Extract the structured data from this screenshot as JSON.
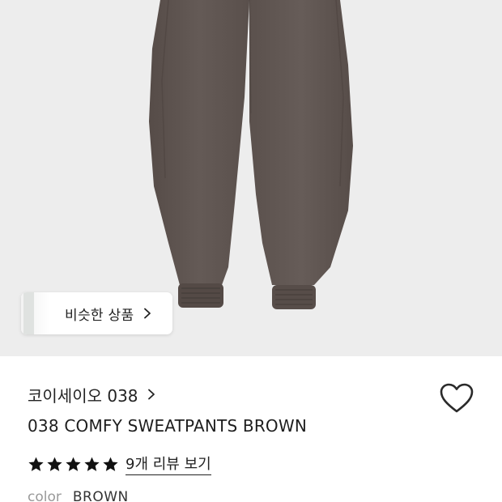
{
  "hero": {
    "product_image": "brown-sweatpants-photo",
    "similar_button_label": "비슷한 상품"
  },
  "product": {
    "brand": "코이세이오 038",
    "title": "038 COMFY SWEATPANTS BROWN",
    "rating": 5,
    "rating_max": 5,
    "review_link_label": "9개 리뷰 보기",
    "option_key": "color",
    "option_value": "BROWN"
  },
  "colors": {
    "pants": "#5e5450",
    "hero_bg": "#ededed",
    "star": "#111111"
  }
}
